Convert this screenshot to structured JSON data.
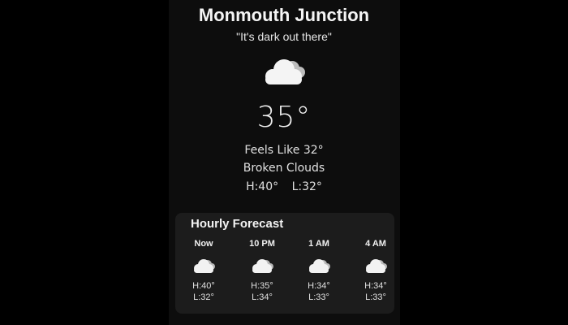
{
  "location": {
    "city": "Monmouth Junction",
    "tagline": "\"It's dark out there\""
  },
  "current": {
    "icon": "cloud-icon",
    "temperature": "35°",
    "feels_like": "Feels Like 32°",
    "condition": "Broken Clouds",
    "high": "H:40°",
    "low": "L:32°"
  },
  "hourly": {
    "title": "Hourly Forecast",
    "items": [
      {
        "time": "Now",
        "icon": "cloud-icon",
        "high": "H:40°",
        "low": "L:32°"
      },
      {
        "time": "10 PM",
        "icon": "cloud-icon",
        "high": "H:35°",
        "low": "L:34°"
      },
      {
        "time": "1 AM",
        "icon": "cloud-icon",
        "high": "H:34°",
        "low": "L:33°"
      },
      {
        "time": "4 AM",
        "icon": "cloud-icon",
        "high": "H:34°",
        "low": "L:33°"
      }
    ]
  },
  "colors": {
    "background": "#000000",
    "panel": "#0d0d0d",
    "card": "#1c1c1c",
    "text": "#ffffff"
  }
}
